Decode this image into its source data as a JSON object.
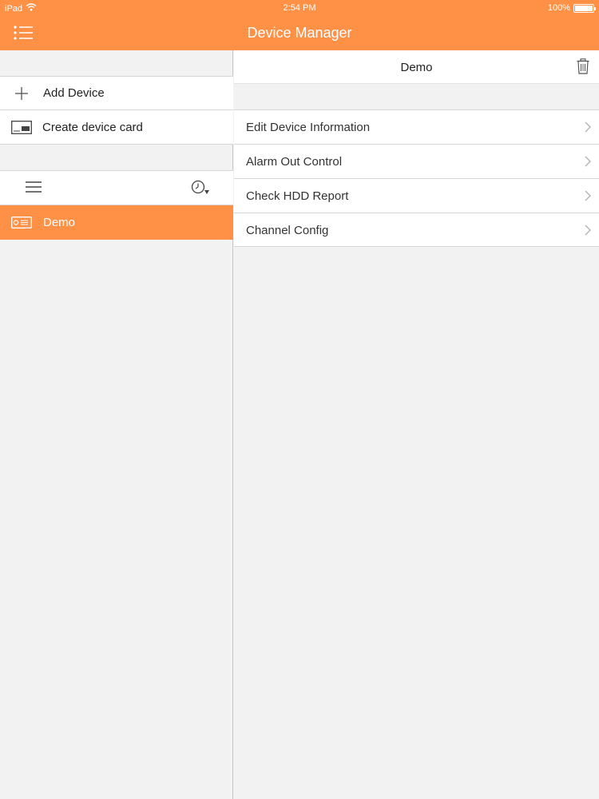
{
  "status_bar": {
    "device": "iPad",
    "time": "2:54 PM",
    "battery": "100%",
    "battery_level": 1.0
  },
  "header": {
    "title": "Device Manager",
    "menu_icon": "list-menu-icon"
  },
  "left_panel": {
    "add_device": {
      "label": "Add Device",
      "icon": "plus-icon"
    },
    "create_card": {
      "label": "Create device card",
      "icon": "device-card-icon"
    },
    "tools": {
      "menu_icon": "hamburger-icon",
      "sort_icon": "clock-sort-icon"
    },
    "devices": [
      {
        "label": "Demo",
        "icon": "dvr-icon",
        "selected": true
      }
    ]
  },
  "right_panel": {
    "title": "Demo",
    "trash_icon": "trash-icon",
    "options": [
      {
        "label": "Edit Device Information"
      },
      {
        "label": "Alarm Out Control"
      },
      {
        "label": "Check HDD Report"
      },
      {
        "label": "Channel Config"
      }
    ]
  },
  "colors": {
    "accent": "#ff9146",
    "background": "#f2f2f2",
    "row_bg": "#ffffff",
    "separator": "#d6d6d6"
  }
}
